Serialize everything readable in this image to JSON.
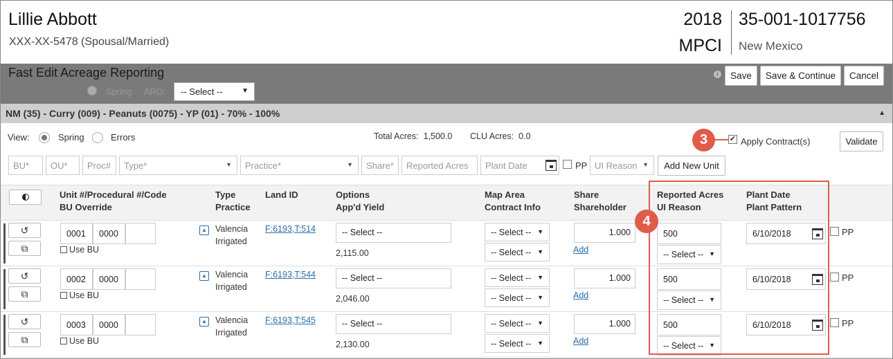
{
  "header": {
    "name": "Lillie Abbott",
    "ssn": "XXX-XX-5478 (Spousal/Married)",
    "year": "2018",
    "program": "MPCI",
    "policy": "35-001-1017756",
    "state": "New Mexico"
  },
  "toolbar": {
    "title": "Fast Edit Acreage Reporting",
    "spring_label": "Spring",
    "ard_label": "ARD:",
    "ard_value": "-- Select --",
    "save_label": "Save",
    "save_continue_label": "Save & Continue",
    "cancel_label": "Cancel",
    "info_icon": "i"
  },
  "section": {
    "title": "NM (35) - Curry (009) - Peanuts (0075) - YP (01) - 70% - 100%"
  },
  "view": {
    "label": "View:",
    "options": [
      "Spring",
      "Errors"
    ],
    "selected": "Spring",
    "total_acres_label": "Total Acres:",
    "total_acres_value": "1,500.0",
    "clu_acres_label": "CLU Acres:",
    "clu_acres_value": "0.0",
    "apply_contracts_label": "Apply Contract(s)",
    "apply_contracts_checked": true,
    "validate_label": "Validate"
  },
  "add_unit": {
    "bu_placeholder": "BU*",
    "ou_placeholder": "OU*",
    "proc_placeholder": "Proc#",
    "type_placeholder": "Type*",
    "practice_placeholder": "Practice*",
    "share_placeholder": "Share*",
    "reported_acres_placeholder": "Reported Acres",
    "plant_date_placeholder": "Plant Date",
    "pp_label": "PP",
    "ui_reason_placeholder": "UI Reason",
    "add_button_label": "Add New Unit"
  },
  "columns": {
    "unit_1": "Unit #/Procedural #/Code",
    "unit_2": "BU Override",
    "type_1": "Type",
    "type_2": "Practice",
    "land_1": "Land ID",
    "options_1": "Options",
    "options_2": "App'd Yield",
    "map_1": "Map Area",
    "map_2": "Contract Info",
    "share_1": "Share",
    "share_2": "Shareholder",
    "acres_1": "Reported Acres",
    "acres_2": "UI Reason",
    "plant_1": "Plant Date",
    "plant_2": "Plant Pattern"
  },
  "rows": [
    {
      "unit": "0001",
      "proc": "0000",
      "use_bu": "Use BU",
      "type": "Valencia",
      "practice": "Irrigated",
      "land_id": "F:6193,T:514",
      "options": "-- Select --",
      "yield": "2,115.00",
      "map_area": "-- Select --",
      "contract": "-- Select --",
      "share": "1.000",
      "add": "Add",
      "acres": "500",
      "ui_reason": "-- Select --",
      "plant_date": "6/10/2018",
      "pp": "PP"
    },
    {
      "unit": "0002",
      "proc": "0000",
      "use_bu": "Use BU",
      "type": "Valencia",
      "practice": "Irrigated",
      "land_id": "F:6193,T:544",
      "options": "-- Select --",
      "yield": "2,046.00",
      "map_area": "-- Select --",
      "contract": "-- Select --",
      "share": "1.000",
      "add": "Add",
      "acres": "500",
      "ui_reason": "-- Select --",
      "plant_date": "6/10/2018",
      "pp": "PP"
    },
    {
      "unit": "0003",
      "proc": "0000",
      "use_bu": "Use BU",
      "type": "Valencia",
      "practice": "Irrigated",
      "land_id": "F:6193,T:545",
      "options": "-- Select --",
      "yield": "2,130.00",
      "map_area": "-- Select --",
      "contract": "-- Select --",
      "share": "1.000",
      "add": "Add",
      "acres": "500",
      "ui_reason": "-- Select --",
      "plant_date": "6/10/2018",
      "pp": "PP"
    }
  ],
  "annotations": {
    "badge_3": "3",
    "badge_4": "4",
    "color": "#e05c4a"
  },
  "icons": {
    "undo": "↺",
    "copy": "⧉",
    "caret_down": "▼",
    "caret_up": "▲",
    "expand": "▲",
    "check": "✔"
  }
}
